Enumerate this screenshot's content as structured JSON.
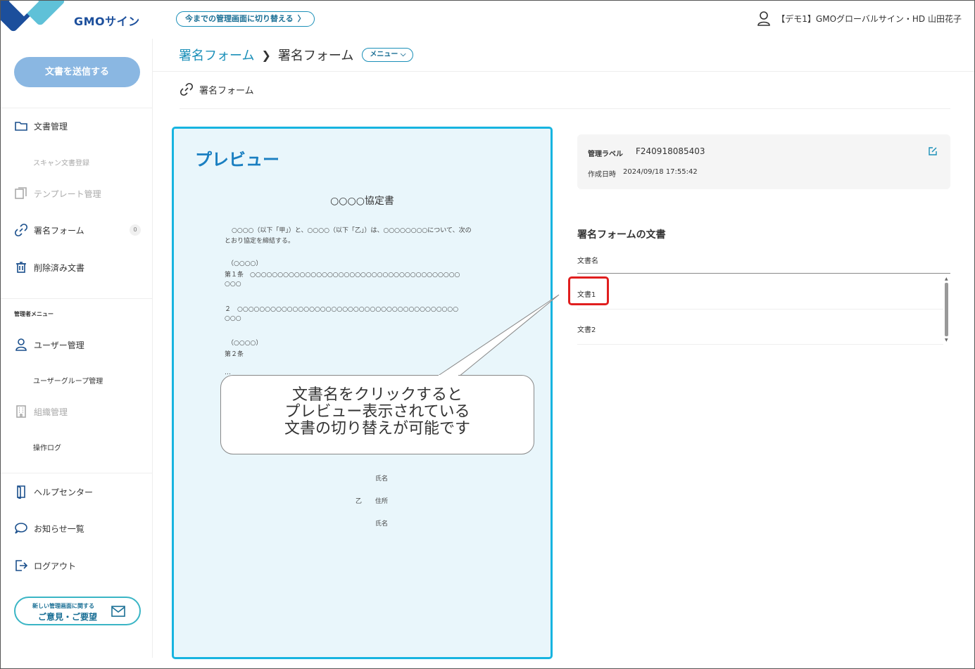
{
  "header": {
    "logo_text": "GMOサイン",
    "switch_button": "今までの管理画面に切り替える",
    "switch_chevron": "〉",
    "user_name": "【デモ1】GMOグローバルサイン・HD 山田花子"
  },
  "sidebar": {
    "send_button": "文書を送信する",
    "items": {
      "document_management": "文書管理",
      "scan_registration": "スキャン文書登録",
      "template_management": "テンプレート管理",
      "signature_form": "署名フォーム",
      "signature_form_count": "0",
      "deleted_documents": "削除済み文書",
      "admin_menu": "管理者メニュー",
      "user_management": "ユーザー管理",
      "user_group_management": "ユーザーグループ管理",
      "org_management": "組織管理",
      "operation_log": "操作ログ",
      "help_center": "ヘルプセンター",
      "notices": "お知らせ一覧",
      "logout": "ログアウト"
    },
    "feedback": {
      "small": "新しい管理画面に関する",
      "large": "ご意見・ご要望"
    }
  },
  "breadcrumb": {
    "parent": "署名フォーム",
    "current": "署名フォーム",
    "menu": "メニュー"
  },
  "form_title": "署名フォーム",
  "preview": {
    "title": "プレビュー",
    "doc_title": "○○○○協定書",
    "lines": [
      "○○○○（以下「甲」）と、○○○○（以下「乙」）は、○○○○○○○○について、次の",
      "とおり協定を締結する。",
      "（○○○○）",
      "第１条　○○○○○○○○○○○○○○○○○○○○○○○○○○○○○○○○○○○○○○",
      "○○○",
      "２　○○○○○○○○○○○○○○○○○○○○○○○○○○○○○○○○○○○○○○○○",
      "○○○",
      "（○○○○）",
      "第２条",
      "…"
    ],
    "sig_name1": "氏名",
    "sig_party2": "乙",
    "sig_address2": "住所",
    "sig_name2": "氏名"
  },
  "callout": {
    "line1": "文書名をクリックすると",
    "line2": "プレビュー表示されている",
    "line3": "文書の切り替えが可能です"
  },
  "info": {
    "label_title": "管理ラベル",
    "label_value": "F240918085403",
    "created_label": "作成日時",
    "created_value": "2024/09/18 17:55:42"
  },
  "docs": {
    "heading": "署名フォームの文書",
    "column": "文書名",
    "rows": [
      "文書1",
      "文書2"
    ]
  },
  "colors": {
    "accent": "#1a8fb8",
    "preview_border": "#17b4e0",
    "highlight": "#e01e1e"
  }
}
